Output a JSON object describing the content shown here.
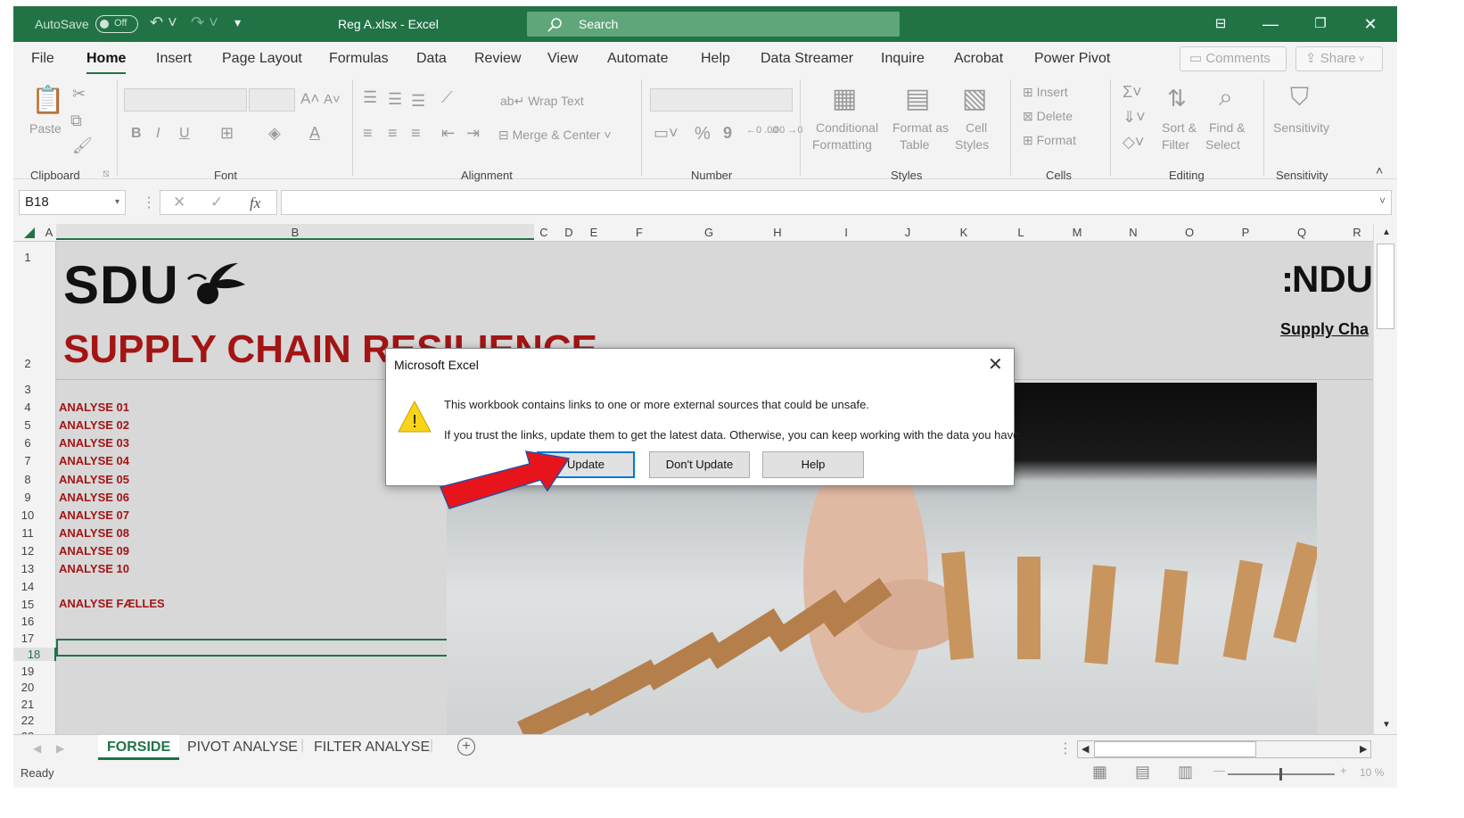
{
  "titlebar": {
    "autosave_label": "AutoSave",
    "autosave_state": "Off",
    "document_title": "Reg A.xlsx  -  Excel",
    "search_placeholder": "Search"
  },
  "menu": {
    "items": [
      "File",
      "Home",
      "Insert",
      "Page Layout",
      "Formulas",
      "Data",
      "Review",
      "View",
      "Automate",
      "Help",
      "Data Streamer",
      "Inquire",
      "Acrobat",
      "Power Pivot"
    ],
    "active": "Home",
    "comments_label": "Comments",
    "share_label": "Share"
  },
  "ribbon": {
    "clipboard": {
      "label": "Clipboard",
      "paste": "Paste"
    },
    "font": {
      "label": "Font",
      "bold": "B",
      "italic": "I",
      "underline": "U",
      "grow": "A^",
      "shrink": "A˅"
    },
    "alignment": {
      "label": "Alignment",
      "wrap_text": "Wrap Text",
      "merge_center": "Merge & Center"
    },
    "number": {
      "label": "Number",
      "percent": "%",
      "comma": "9",
      "inc_decimal": "←0 .00",
      "dec_decimal": ".00 →0"
    },
    "styles": {
      "label": "Styles",
      "conditional_1": "Conditional",
      "conditional_2": "Formatting",
      "format_table_1": "Format as",
      "format_table_2": "Table",
      "cell_styles_1": "Cell",
      "cell_styles_2": "Styles"
    },
    "cells": {
      "label": "Cells",
      "insert": "Insert",
      "delete": "Delete",
      "format": "Format"
    },
    "editing": {
      "label": "Editing",
      "sort_1": "Sort &",
      "sort_2": "Filter",
      "find_1": "Find &",
      "find_2": "Select"
    },
    "sensitivity": {
      "label": "Sensitivity",
      "button": "Sensitivity"
    }
  },
  "formula_bar": {
    "name_box": "B18",
    "fx": "fx",
    "content": ""
  },
  "columns": [
    "A",
    "B",
    "C",
    "D",
    "E",
    "F",
    "G",
    "H",
    "I",
    "J",
    "K",
    "L",
    "M",
    "N",
    "O",
    "P",
    "Q",
    "R"
  ],
  "rows": [
    "1",
    "2",
    "3",
    "4",
    "5",
    "6",
    "7",
    "8",
    "9",
    "10",
    "11",
    "12",
    "13",
    "14",
    "15",
    "16",
    "17",
    "18",
    "19",
    "20",
    "21",
    "22",
    "23"
  ],
  "sheet": {
    "logo_text": "SDU",
    "heading": "SUPPLY CHAIN RESILIENCE",
    "right_heading": "NDU",
    "right_subheading": "Supply Cha",
    "analyses": [
      "ANALYSE 01",
      "ANALYSE 02",
      "ANALYSE 03",
      "ANALYSE 04",
      "ANALYSE 05",
      "ANALYSE 06",
      "ANALYSE 07",
      "ANALYSE 08",
      "ANALYSE 09",
      "ANALYSE 10"
    ],
    "analyse_faelles": "ANALYSE FÆLLES"
  },
  "dialog": {
    "title": "Microsoft Excel",
    "message_1": "This workbook contains links to one or more external sources that could be unsafe.",
    "message_2": "If you trust the links, update them to get the latest data. Otherwise, you can keep working with the data you have.",
    "update": "Update",
    "dont_update": "Don't Update",
    "help": "Help"
  },
  "tabs": {
    "items": [
      "FORSIDE",
      "PIVOT ANALYSE",
      "FILTER ANALYSE"
    ],
    "active": "FORSIDE"
  },
  "status": {
    "ready": "Ready",
    "zoom": "10 %"
  },
  "colors": {
    "excel_green": "#217346",
    "accent_red": "#a31515",
    "arrow_red": "#e8141b"
  }
}
